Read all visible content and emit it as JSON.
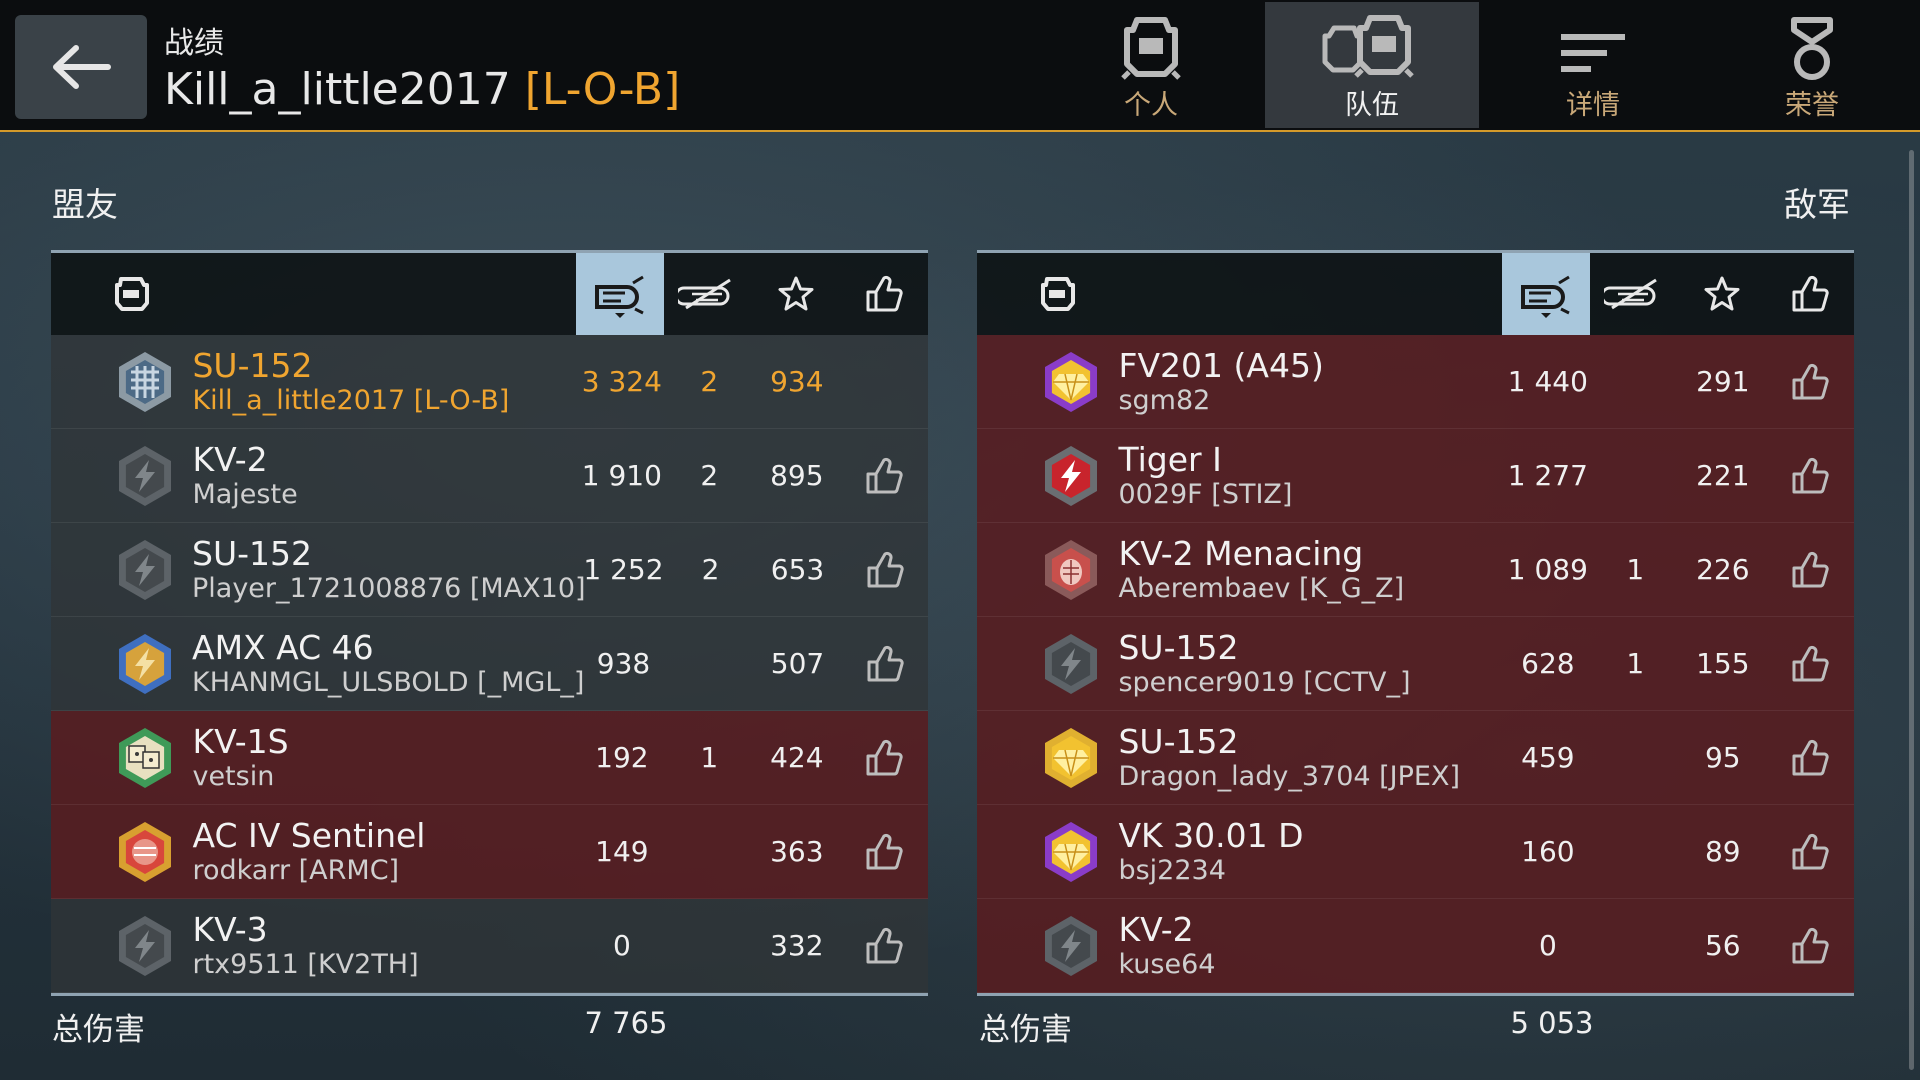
{
  "header": {
    "subtitle": "战绩",
    "player_name": "Kill_a_little2017",
    "player_tag": "[L-O-B]"
  },
  "tabs": [
    {
      "label": "个人",
      "icon": "single-tank-icon",
      "active": false
    },
    {
      "label": "队伍",
      "icon": "team-tanks-icon",
      "active": true
    },
    {
      "label": "详情",
      "icon": "details-lines-icon",
      "active": false
    },
    {
      "label": "荣誉",
      "icon": "medal-icon",
      "active": false
    }
  ],
  "allies": {
    "title": "盟友",
    "total_label": "总伤害",
    "total_damage": "7 765",
    "rows": [
      {
        "tank": "SU-152",
        "player": "Kill_a_little2017 [L-O-B]",
        "damage": "3 324",
        "kills": "2",
        "xp": "934",
        "self": true,
        "badge": "silver-blue",
        "alive": false
      },
      {
        "tank": "KV-2",
        "player": "Majeste",
        "damage": "1 910",
        "kills": "2",
        "xp": "895",
        "self": false,
        "badge": "grey",
        "alive": false
      },
      {
        "tank": "SU-152",
        "player": "Player_1721008876 [MAX10]",
        "damage": "1 252",
        "kills": "2",
        "xp": "653",
        "self": false,
        "badge": "grey",
        "alive": false
      },
      {
        "tank": "AMX AC 46",
        "player": "KHANMGL_ULSBOLD [_MGL_]",
        "damage": "938",
        "kills": "",
        "xp": "507",
        "self": false,
        "badge": "blue-gold",
        "alive": false
      },
      {
        "tank": "KV-1S",
        "player": "vetsin",
        "damage": "192",
        "kills": "1",
        "xp": "424",
        "self": false,
        "badge": "green-dice",
        "alive": true
      },
      {
        "tank": "AC IV Sentinel",
        "player": "rodkarr [ARMC]",
        "damage": "149",
        "kills": "",
        "xp": "363",
        "self": false,
        "badge": "gold-red",
        "alive": true
      },
      {
        "tank": "KV-3",
        "player": "rtx9511 [KV2TH]",
        "damage": "0",
        "kills": "",
        "xp": "332",
        "self": false,
        "badge": "grey",
        "alive": false
      }
    ]
  },
  "enemies": {
    "title": "敌军",
    "total_label": "总伤害",
    "total_damage": "5 053",
    "rows": [
      {
        "tank": "FV201 (A45)",
        "player": "sgm82",
        "damage": "1 440",
        "kills": "",
        "xp": "291",
        "badge": "purple-gem",
        "alive": true
      },
      {
        "tank": "Tiger I",
        "player": "0029F [STIZ]",
        "damage": "1 277",
        "kills": "",
        "xp": "221",
        "badge": "red-bolt",
        "alive": true
      },
      {
        "tank": "KV-2 Menacing",
        "player": "Aberembaev [K_G_Z]",
        "damage": "1 089",
        "kills": "1",
        "xp": "226",
        "badge": "red-grenade",
        "alive": true
      },
      {
        "tank": "SU-152",
        "player": "spencer9019 [CCTV_]",
        "damage": "628",
        "kills": "1",
        "xp": "155",
        "badge": "grey",
        "alive": true
      },
      {
        "tank": "SU-152",
        "player": "Dragon_lady_3704 [JPEX]",
        "damage": "459",
        "kills": "",
        "xp": "95",
        "badge": "gold-gem",
        "alive": true
      },
      {
        "tank": "VK 30.01 D",
        "player": "bsj2234",
        "damage": "160",
        "kills": "",
        "xp": "89",
        "badge": "purple-gem",
        "alive": true
      },
      {
        "tank": "KV-2",
        "player": "kuse64",
        "damage": "0",
        "kills": "",
        "xp": "56",
        "badge": "grey",
        "alive": true
      }
    ]
  },
  "colors": {
    "accent_orange": "#f0a530",
    "sorted_col_bg": "#a9c7dc",
    "enemy_row_bg": "#581c20"
  }
}
